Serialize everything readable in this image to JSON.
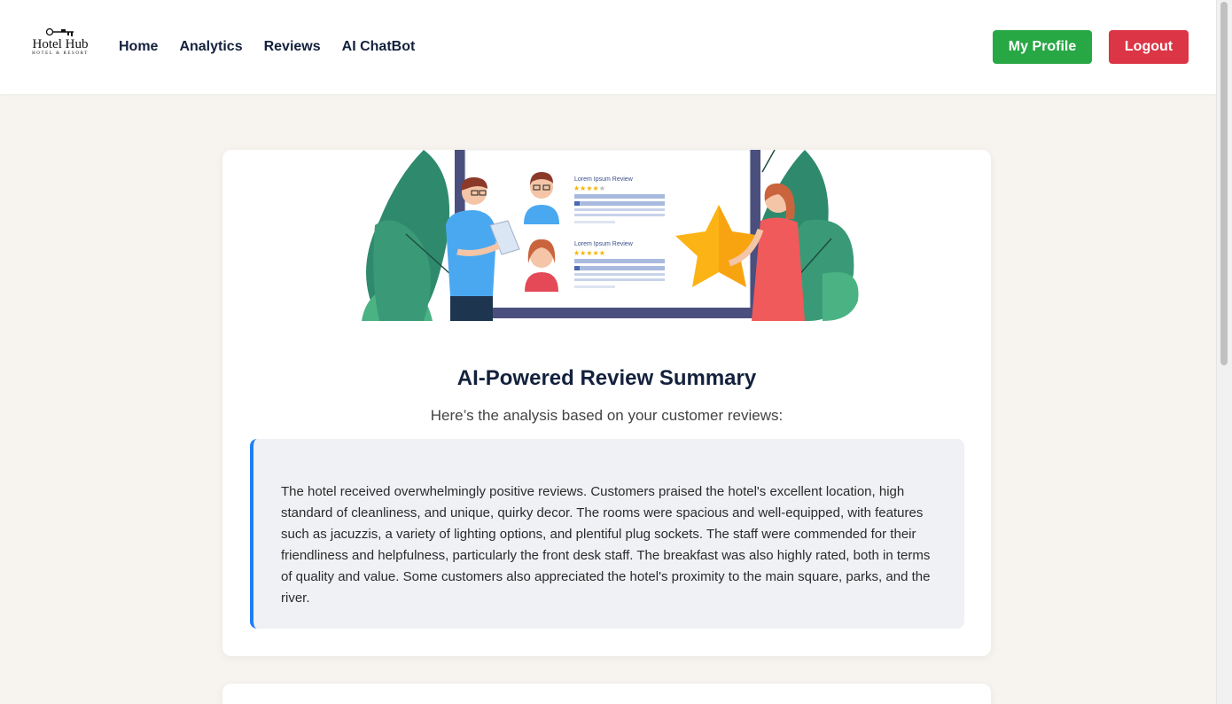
{
  "brand": {
    "name": "Hotel Hub",
    "tagline": "HOTEL & RESORT"
  },
  "nav": {
    "items": [
      {
        "label": "Home"
      },
      {
        "label": "Analytics"
      },
      {
        "label": "Reviews"
      },
      {
        "label": "AI ChatBot"
      }
    ]
  },
  "header": {
    "profile_label": "My Profile",
    "logout_label": "Logout"
  },
  "colors": {
    "profile_button": "#28a745",
    "logout_button": "#dc3545",
    "accent_border": "#1e7ef2",
    "title": "#14213d"
  },
  "illustration": {
    "review_card_1_title": "Lorem Ipsum Review",
    "review_card_2_title": "Lorem Ipsum Review"
  },
  "summary": {
    "title": "AI-Powered Review Summary",
    "subtitle": "Here’s the analysis based on your customer reviews:",
    "text": "The hotel received overwhelmingly positive reviews. Customers praised the hotel's excellent location, high standard of cleanliness, and unique, quirky decor. The rooms were spacious and well-equipped, with features such as jacuzzis, a variety of lighting options, and plentiful plug sockets. The staff were commended for their friendliness and helpfulness, particularly the front desk staff. The breakfast was also highly rated, both in terms of quality and value. Some customers also appreciated the hotel's proximity to the main square, parks, and the river."
  }
}
